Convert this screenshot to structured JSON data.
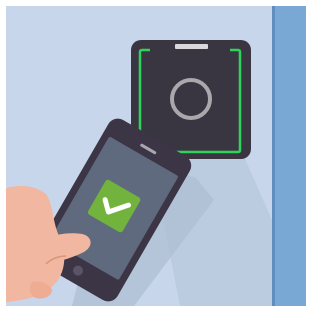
{
  "illustration": {
    "subject": "phone-tap-access-reader",
    "status": "access-granted",
    "icons": {
      "reader": "nfc-reader-icon",
      "check": "checkmark-icon"
    }
  },
  "colors": {
    "wall": "#c7d6eb",
    "wall_edge": "#7aa8d5",
    "reader_body": "#3a3641",
    "reader_led": "#2fd35a",
    "reader_ring": "#a9a9ad",
    "phone_body": "#3b3546",
    "phone_screen": "#5f6a7e",
    "check_badge": "#71b33c",
    "check_mark": "#ffffff",
    "hand": "#f2b7a0",
    "shadow": "#aebdd3"
  }
}
